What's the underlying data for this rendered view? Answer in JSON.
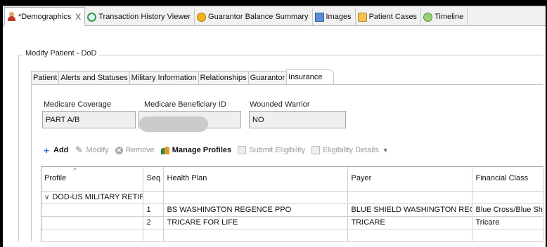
{
  "tabs": [
    {
      "label": "*Demographics",
      "icon": "patient-person-icon",
      "active": true,
      "closable": true
    },
    {
      "label": "Transaction History Viewer",
      "icon": "clock-icon"
    },
    {
      "label": "Guarantor Balance Summary",
      "icon": "coin-icon"
    },
    {
      "label": "Images",
      "icon": "image-icon"
    },
    {
      "label": "Patient Cases",
      "icon": "folder-icon"
    },
    {
      "label": "Timeline",
      "icon": "timeline-icon"
    }
  ],
  "close_glyph": "X",
  "panel_title": "Modify Patient - DoD",
  "subtabs": [
    "Patient",
    "Alerts and Statuses",
    "Military Information",
    "Relationships",
    "Guarantor",
    "Insurance"
  ],
  "fields": {
    "medicare_coverage": {
      "label": "Medicare Coverage",
      "value": "PART A/B"
    },
    "medicare_beneficiary_id": {
      "label": "Medicare Beneficiary ID",
      "value": ""
    },
    "wounded_warrior": {
      "label": "Wounded Warrior",
      "value": "NO"
    }
  },
  "toolbar": {
    "add": "Add",
    "modify": "Modify",
    "remove": "Remove",
    "manage_profiles": "Manage Profiles",
    "submit_eligibility": "Submit Eligibility",
    "eligibility_details": "Eligibility Details"
  },
  "table": {
    "columns": [
      "Profile",
      "Seq",
      "Health Plan",
      "Payer",
      "Financial Class"
    ],
    "group": "DOD-US MILITARY RETIRED",
    "rows": [
      {
        "seq": "1",
        "health_plan": "BS WASHINGTON REGENCE PPO",
        "payer": "BLUE SHIELD WASHINGTON REGENCE",
        "financial_class": "Blue Cross/Blue Shield"
      },
      {
        "seq": "2",
        "health_plan": "TRICARE FOR LIFE",
        "payer": "TRICARE",
        "financial_class": "Tricare"
      }
    ]
  }
}
